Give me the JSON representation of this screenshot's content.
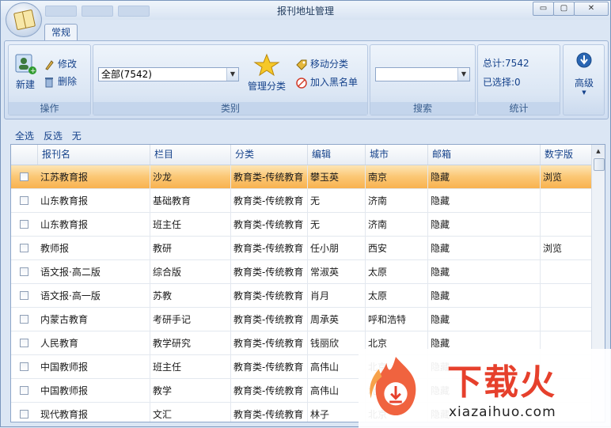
{
  "window": {
    "title": "报刊地址管理",
    "controls": {
      "minimize": "▭",
      "maximize": "▢",
      "close": "✕"
    }
  },
  "ribbon": {
    "tab": "常规",
    "groups": {
      "operate": {
        "label": "操作",
        "new": "新建",
        "edit": "修改",
        "delete": "删除"
      },
      "category": {
        "label": "类别",
        "combo_value": "全部(7542)",
        "manage": "管理分类",
        "move": "移动分类",
        "blacklist": "加入黑名单"
      },
      "search": {
        "label": "搜索",
        "combo_value": ""
      },
      "stats": {
        "label": "统计",
        "total": "总计:7542",
        "selected": "已选择:0"
      },
      "advanced": {
        "label": "高级"
      }
    }
  },
  "selection": {
    "all": "全选",
    "invert": "反选",
    "none": "无"
  },
  "grid": {
    "columns": [
      "报刊名",
      "栏目",
      "分类",
      "编辑",
      "城市",
      "邮箱",
      "数字版"
    ],
    "rows": [
      {
        "name": "江苏教育报",
        "column": "沙龙",
        "category": "教育类-传统教育",
        "editor": "攀玉英",
        "city": "南京",
        "email": "隐藏",
        "digital": "浏览",
        "selected": true
      },
      {
        "name": "山东教育报",
        "column": "基础教育",
        "category": "教育类-传统教育",
        "editor": "无",
        "city": "济南",
        "email": "隐藏",
        "digital": ""
      },
      {
        "name": "山东教育报",
        "column": "班主任",
        "category": "教育类-传统教育",
        "editor": "无",
        "city": "济南",
        "email": "隐藏",
        "digital": ""
      },
      {
        "name": "教师报",
        "column": "教研",
        "category": "教育类-传统教育",
        "editor": "任小朋",
        "city": "西安",
        "email": "隐藏",
        "digital": "浏览"
      },
      {
        "name": "语文报·高二版",
        "column": "综合版",
        "category": "教育类-传统教育",
        "editor": "常淑英",
        "city": "太原",
        "email": "隐藏",
        "digital": ""
      },
      {
        "name": "语文报·高一版",
        "column": "苏教",
        "category": "教育类-传统教育",
        "editor": "肖月",
        "city": "太原",
        "email": "隐藏",
        "digital": ""
      },
      {
        "name": "内蒙古教育",
        "column": "考研手记",
        "category": "教育类-传统教育",
        "editor": "周承英",
        "city": "呼和浩特",
        "email": "隐藏",
        "digital": ""
      },
      {
        "name": "人民教育",
        "column": "教学研究",
        "category": "教育类-传统教育",
        "editor": "钱丽欣",
        "city": "北京",
        "email": "隐藏",
        "digital": ""
      },
      {
        "name": "中国教师报",
        "column": "班主任",
        "category": "教育类-传统教育",
        "editor": "高伟山",
        "city": "北京",
        "email": "隐藏",
        "digital": ""
      },
      {
        "name": "中国教师报",
        "column": "教学",
        "category": "教育类-传统教育",
        "editor": "高伟山",
        "city": "北京",
        "email": "隐藏",
        "digital": ""
      },
      {
        "name": "现代教育报",
        "column": "文汇",
        "category": "教育类-传统教育",
        "editor": "林子",
        "city": "北京",
        "email": "隐藏",
        "digital": ""
      }
    ]
  },
  "watermark": {
    "title": "下载火",
    "url": "xiazaihuo.com"
  },
  "colors": {
    "selected_row": "#fbc774",
    "ribbon": "#dbe6f4",
    "label_blue": "#15428b",
    "watermark_red": "#e6402c"
  }
}
